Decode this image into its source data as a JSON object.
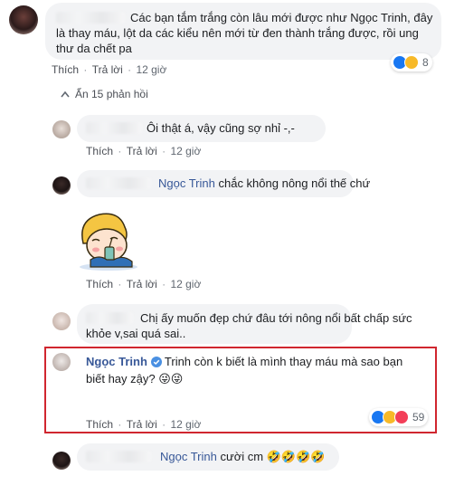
{
  "comments": [
    {
      "text": "Các bạn tắm trắng còn lâu mới được như Ngọc Trinh, đây là thay máu, lột da các kiểu nên mới từ đen thành trắng được, rồi ung thư da chết pa",
      "line1": "Các bạn tắm trắng còn lâu mới được như Ngọc Trinh, đây",
      "line2": "là thay máu, lột da các kiểu nên mới từ đen thành trắng được, rồi ung",
      "line3": "thư da chết pa",
      "like": "Thích",
      "reply": "Trả lời",
      "time": "12 giờ",
      "reactions": [
        "like",
        "haha"
      ],
      "reaction_count": "8"
    }
  ],
  "replies_toggle": "Ẩn 15 phản hồi",
  "replies": [
    {
      "text": "Ôi thật á, vậy cũng sợ nhỉ -,-",
      "like": "Thích",
      "reply": "Trả lời",
      "time": "12 giờ"
    },
    {
      "tag": "Ngọc Trinh",
      "text": " chắc không nông nổi thế chứ",
      "like": "Thích",
      "reply": "Trả lời",
      "time": "12 giờ"
    },
    {
      "sticker": "boy-drinking-sticker",
      "like": "Thích",
      "reply": "Trả lời",
      "time": "12 giờ"
    },
    {
      "line1": "Chị ấy muốn đẹp chứ đâu tới nông nổi bất chấp sức",
      "line2": "khỏe v,sai quá sai..",
      "like": "Thích",
      "reply": "Trả lời",
      "time": "12 giờ"
    },
    {
      "author": "Ngọc Trinh",
      "verified": true,
      "line1": "Trinh còn k biết là mình thay máu mà sao bạn",
      "line2": "biết hay zậy?",
      "emoji": "😜😜",
      "like": "Thích",
      "reply": "Trả lời",
      "time": "12 giờ",
      "reactions": [
        "like",
        "haha",
        "love"
      ],
      "reaction_count": "59"
    },
    {
      "tag": "Ngọc Trinh",
      "text": " cười cm",
      "emoji": "🤣🤣🤣🤣",
      "like": "Thích",
      "reply": "Trả lời",
      "time": "12 giờ"
    }
  ],
  "colors": {
    "link": "#385898",
    "highlight": "#d0262f",
    "bubble": "#f2f3f5"
  }
}
